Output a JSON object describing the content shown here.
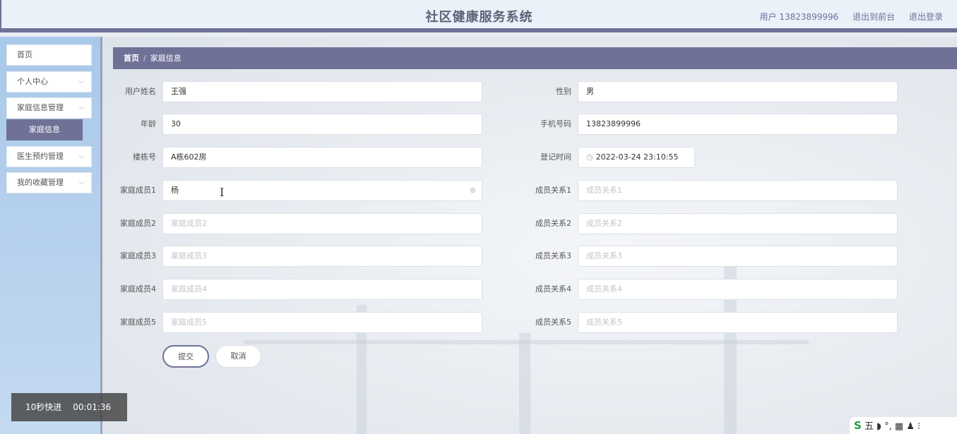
{
  "header": {
    "title": "社区健康服务系统",
    "user_label": "用户 13823899996",
    "to_frontend": "退出到前台",
    "logout": "退出登录"
  },
  "sidebar": {
    "items": [
      {
        "label": "首页"
      },
      {
        "label": "个人中心"
      },
      {
        "label": "家庭信息管理"
      },
      {
        "label": "医生预约管理"
      },
      {
        "label": "我的收藏管理"
      }
    ],
    "active_sub": "家庭信息",
    "chevron": "chevron-down-icon"
  },
  "breadcrumb": {
    "home": "首页",
    "separator": "/",
    "current": "家庭信息"
  },
  "form": {
    "username": {
      "label": "用户姓名",
      "value": "王强"
    },
    "gender": {
      "label": "性别",
      "value": "男"
    },
    "age": {
      "label": "年龄",
      "value": "30"
    },
    "phone": {
      "label": "手机号码",
      "value": "13823899996"
    },
    "building": {
      "label": "楼栋号",
      "value": "A栋602房"
    },
    "reg_time": {
      "label": "登记时间",
      "value": "2022-03-24 23:10:55"
    },
    "member1": {
      "label": "家庭成员1",
      "value": "杨"
    },
    "relation1": {
      "label": "成员关系1",
      "placeholder": "成员关系1"
    },
    "member2": {
      "label": "家庭成员2",
      "placeholder": "家庭成员2"
    },
    "relation2": {
      "label": "成员关系2",
      "placeholder": "成员关系2"
    },
    "member3": {
      "label": "家庭成员3",
      "placeholder": "家庭成员3"
    },
    "relation3": {
      "label": "成员关系3",
      "placeholder": "成员关系3"
    },
    "member4": {
      "label": "家庭成员4",
      "placeholder": "家庭成员4"
    },
    "relation4": {
      "label": "成员关系4",
      "placeholder": "成员关系4"
    },
    "member5": {
      "label": "家庭成员5",
      "placeholder": "家庭成员5"
    },
    "relation5": {
      "label": "成员关系5",
      "placeholder": "成员关系5"
    },
    "submit": "提交",
    "cancel": "取消"
  },
  "overlay": {
    "fast_forward": "10秒快进",
    "time": "00:01:36"
  },
  "ime": {
    "logo": "S",
    "mode": "五",
    "icons": "◗ °, ▦ ♟ ⁝"
  },
  "colors": {
    "accent": "#6f7196",
    "sidebar_bg": "#b8d2ee",
    "header_bg": "#e9f1f9"
  }
}
